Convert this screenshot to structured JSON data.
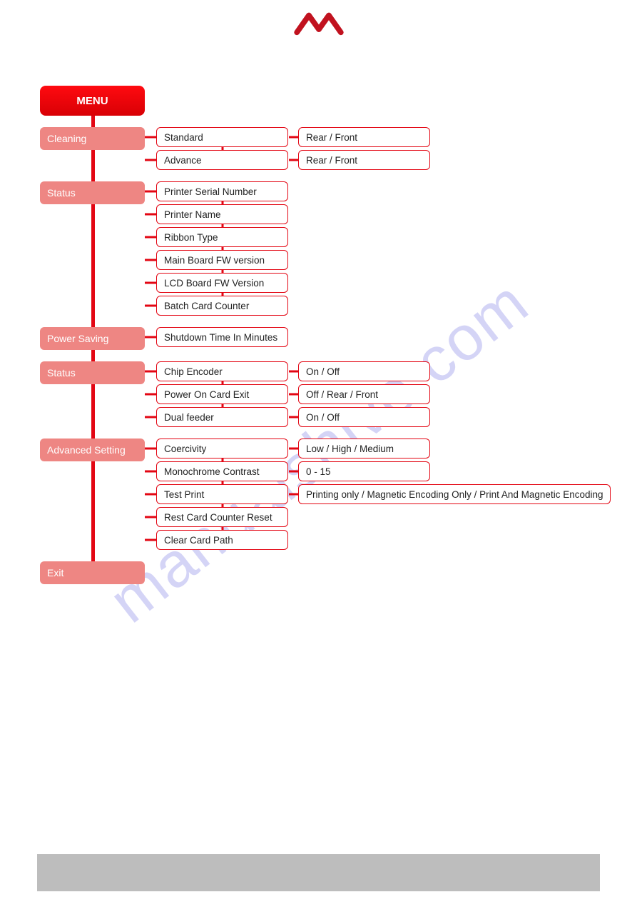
{
  "watermark": "manualshive.com",
  "menu_label": "MENU",
  "sections": [
    {
      "name": "Cleaning",
      "items": [
        {
          "label": "Standard",
          "options": "Rear / Front"
        },
        {
          "label": "Advance",
          "options": "Rear / Front"
        }
      ]
    },
    {
      "name": "Status",
      "items": [
        {
          "label": "Printer Serial Number"
        },
        {
          "label": "Printer Name"
        },
        {
          "label": "Ribbon Type"
        },
        {
          "label": "Main Board FW version"
        },
        {
          "label": "LCD Board FW Version"
        },
        {
          "label": "Batch Card Counter"
        }
      ]
    },
    {
      "name": "Power Saving",
      "items": [
        {
          "label": "Shutdown Time In Minutes"
        }
      ]
    },
    {
      "name": "Status",
      "items": [
        {
          "label": "Chip Encoder",
          "options": "On / Off"
        },
        {
          "label": "Power On Card Exit",
          "options": "Off / Rear / Front"
        },
        {
          "label": "Dual feeder",
          "options": "On / Off"
        }
      ]
    },
    {
      "name": "Advanced  Setting",
      "items": [
        {
          "label": "Coercivity",
          "options": "Low / High / Medium"
        },
        {
          "label": "Monochrome Contrast",
          "options": "0 - 15"
        },
        {
          "label": "Test Print",
          "options": "Printing only / Magnetic Encoding Only / Print And Magnetic Encoding",
          "wide": true
        },
        {
          "label": "Rest Card Counter Reset"
        },
        {
          "label": "Clear Card Path"
        }
      ]
    },
    {
      "name": "Exit",
      "items": []
    }
  ]
}
